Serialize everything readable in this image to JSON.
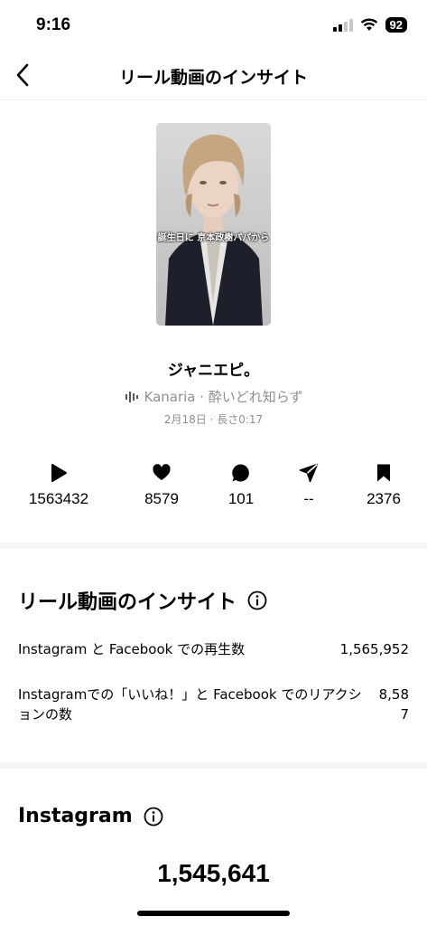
{
  "status": {
    "time": "9:16",
    "battery": "92"
  },
  "header": {
    "title": "リール動画のインサイト"
  },
  "reel": {
    "caption": "誕生日に 京本政樹パパから",
    "title": "ジャニエピ。",
    "audio": "Kanaria · 酔いどれ知らず",
    "meta": "2月18日 · 長さ0:17"
  },
  "stats": [
    {
      "icon": "play-icon",
      "value": "1563432"
    },
    {
      "icon": "heart-icon",
      "value": "8579"
    },
    {
      "icon": "comment-icon",
      "value": "101"
    },
    {
      "icon": "share-icon",
      "value": "--"
    },
    {
      "icon": "bookmark-icon",
      "value": "2376"
    }
  ],
  "insights": {
    "title": "リール動画のインサイト",
    "rows": [
      {
        "label": "Instagram と Facebook での再生数",
        "value": "1,565,952"
      },
      {
        "label": "Instagramでの「いいね！」と Facebook でのリアクションの数",
        "value": "8,587"
      }
    ]
  },
  "instagram": {
    "title": "Instagram",
    "total": "1,545,641"
  },
  "colors": {
    "secondary_text": "#8e8e8e",
    "divider": "#f5f5f5"
  }
}
